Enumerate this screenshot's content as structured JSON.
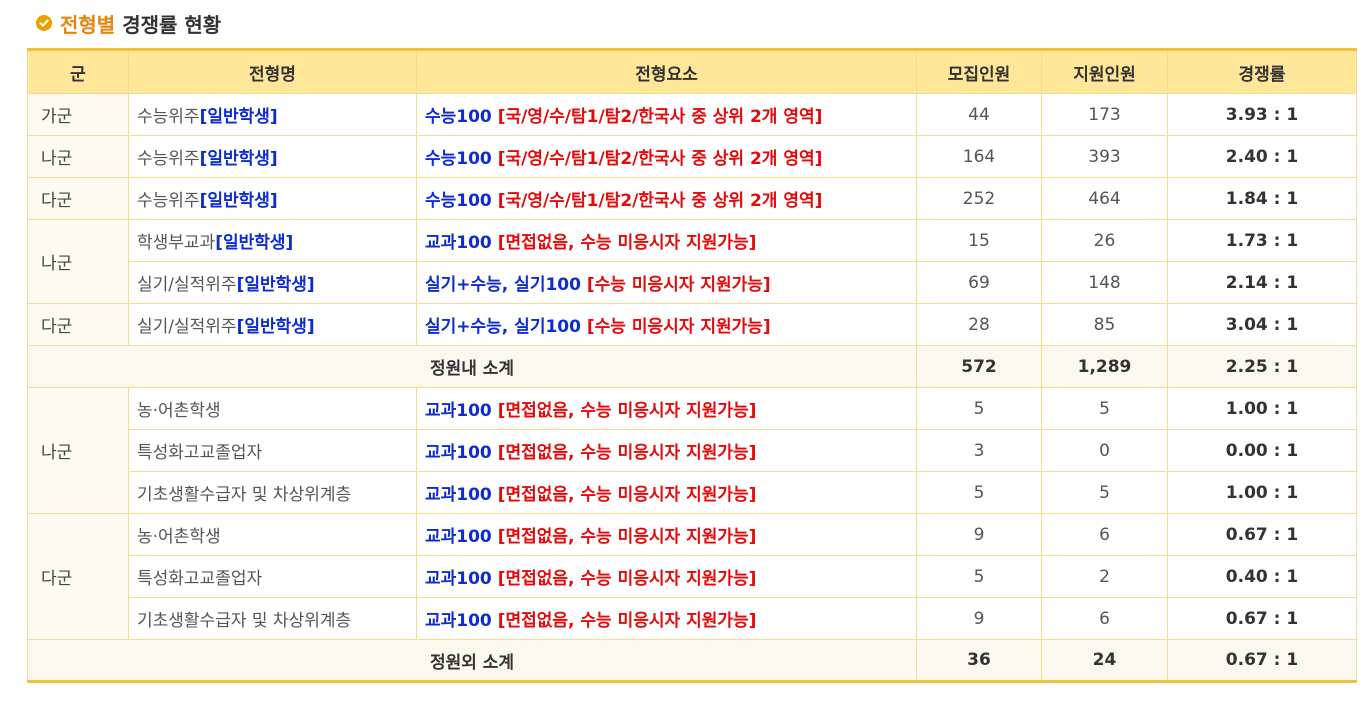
{
  "heading": {
    "accent": "전형별",
    "rest": "경쟁률 현황"
  },
  "colors": {
    "accent": "#e8860c",
    "header_bg": "#ffe79a",
    "border": "#f0c040",
    "blue": "#0c2bd2",
    "red": "#e20a0a"
  },
  "table": {
    "headers": [
      "군",
      "전형명",
      "전형요소",
      "모집인원",
      "지원인원",
      "경쟁률"
    ],
    "rows": [
      {
        "group": "가군",
        "name_base": "수능위주",
        "name_tag": "[일반학생]",
        "elem_blue": "수능100",
        "elem_red": "[국/영/수/탐1/탐2/한국사 중 상위 2개 영역]",
        "quota": "44",
        "applicants": "173",
        "ratio": "3.93 : 1"
      },
      {
        "group": "나군",
        "name_base": "수능위주",
        "name_tag": "[일반학생]",
        "elem_blue": "수능100",
        "elem_red": "[국/영/수/탐1/탐2/한국사 중 상위 2개 영역]",
        "quota": "164",
        "applicants": "393",
        "ratio": "2.40 : 1"
      },
      {
        "group": "다군",
        "name_base": "수능위주",
        "name_tag": "[일반학생]",
        "elem_blue": "수능100",
        "elem_red": "[국/영/수/탐1/탐2/한국사 중 상위 2개 영역]",
        "quota": "252",
        "applicants": "464",
        "ratio": "1.84 : 1"
      },
      {
        "group": "나군",
        "name_base": "학생부교과",
        "name_tag": "[일반학생]",
        "elem_blue": "교과100",
        "elem_red": "[면접없음, 수능 미응시자 지원가능]",
        "quota": "15",
        "applicants": "26",
        "ratio": "1.73 : 1"
      },
      {
        "name_base": "실기/실적위주",
        "name_tag": "[일반학생]",
        "elem_blue": "실기+수능, 실기100",
        "elem_red": "[수능 미응시자 지원가능]",
        "quota": "69",
        "applicants": "148",
        "ratio": "2.14 : 1"
      },
      {
        "group": "다군",
        "name_base": "실기/실적위주",
        "name_tag": "[일반학생]",
        "elem_blue": "실기+수능, 실기100",
        "elem_red": "[수능 미응시자 지원가능]",
        "quota": "28",
        "applicants": "85",
        "ratio": "3.04 : 1"
      },
      {
        "group": "나군",
        "name_base": "농·어촌학생",
        "elem_blue": "교과100",
        "elem_red": "[면접없음, 수능 미응시자 지원가능]",
        "quota": "5",
        "applicants": "5",
        "ratio": "1.00 : 1"
      },
      {
        "name_base": "특성화고교졸업자",
        "elem_blue": "교과100",
        "elem_red": "[면접없음, 수능 미응시자 지원가능]",
        "quota": "3",
        "applicants": "0",
        "ratio": "0.00 : 1"
      },
      {
        "name_base": "기초생활수급자 및 차상위계층",
        "elem_blue": "교과100",
        "elem_red": "[면접없음, 수능 미응시자 지원가능]",
        "quota": "5",
        "applicants": "5",
        "ratio": "1.00 : 1"
      },
      {
        "group": "다군",
        "name_base": "농·어촌학생",
        "elem_blue": "교과100",
        "elem_red": "[면접없음, 수능 미응시자 지원가능]",
        "quota": "9",
        "applicants": "6",
        "ratio": "0.67 : 1"
      },
      {
        "name_base": "특성화고교졸업자",
        "elem_blue": "교과100",
        "elem_red": "[면접없음, 수능 미응시자 지원가능]",
        "quota": "5",
        "applicants": "2",
        "ratio": "0.40 : 1"
      },
      {
        "name_base": "기초생활수급자 및 차상위계층",
        "elem_blue": "교과100",
        "elem_red": "[면접없음, 수능 미응시자 지원가능]",
        "quota": "9",
        "applicants": "6",
        "ratio": "0.67 : 1"
      }
    ],
    "subtotal_in": {
      "label": "정원내 소계",
      "quota": "572",
      "applicants": "1,289",
      "ratio": "2.25 : 1"
    },
    "subtotal_out": {
      "label": "정원외 소계",
      "quota": "36",
      "applicants": "24",
      "ratio": "0.67 : 1"
    }
  }
}
